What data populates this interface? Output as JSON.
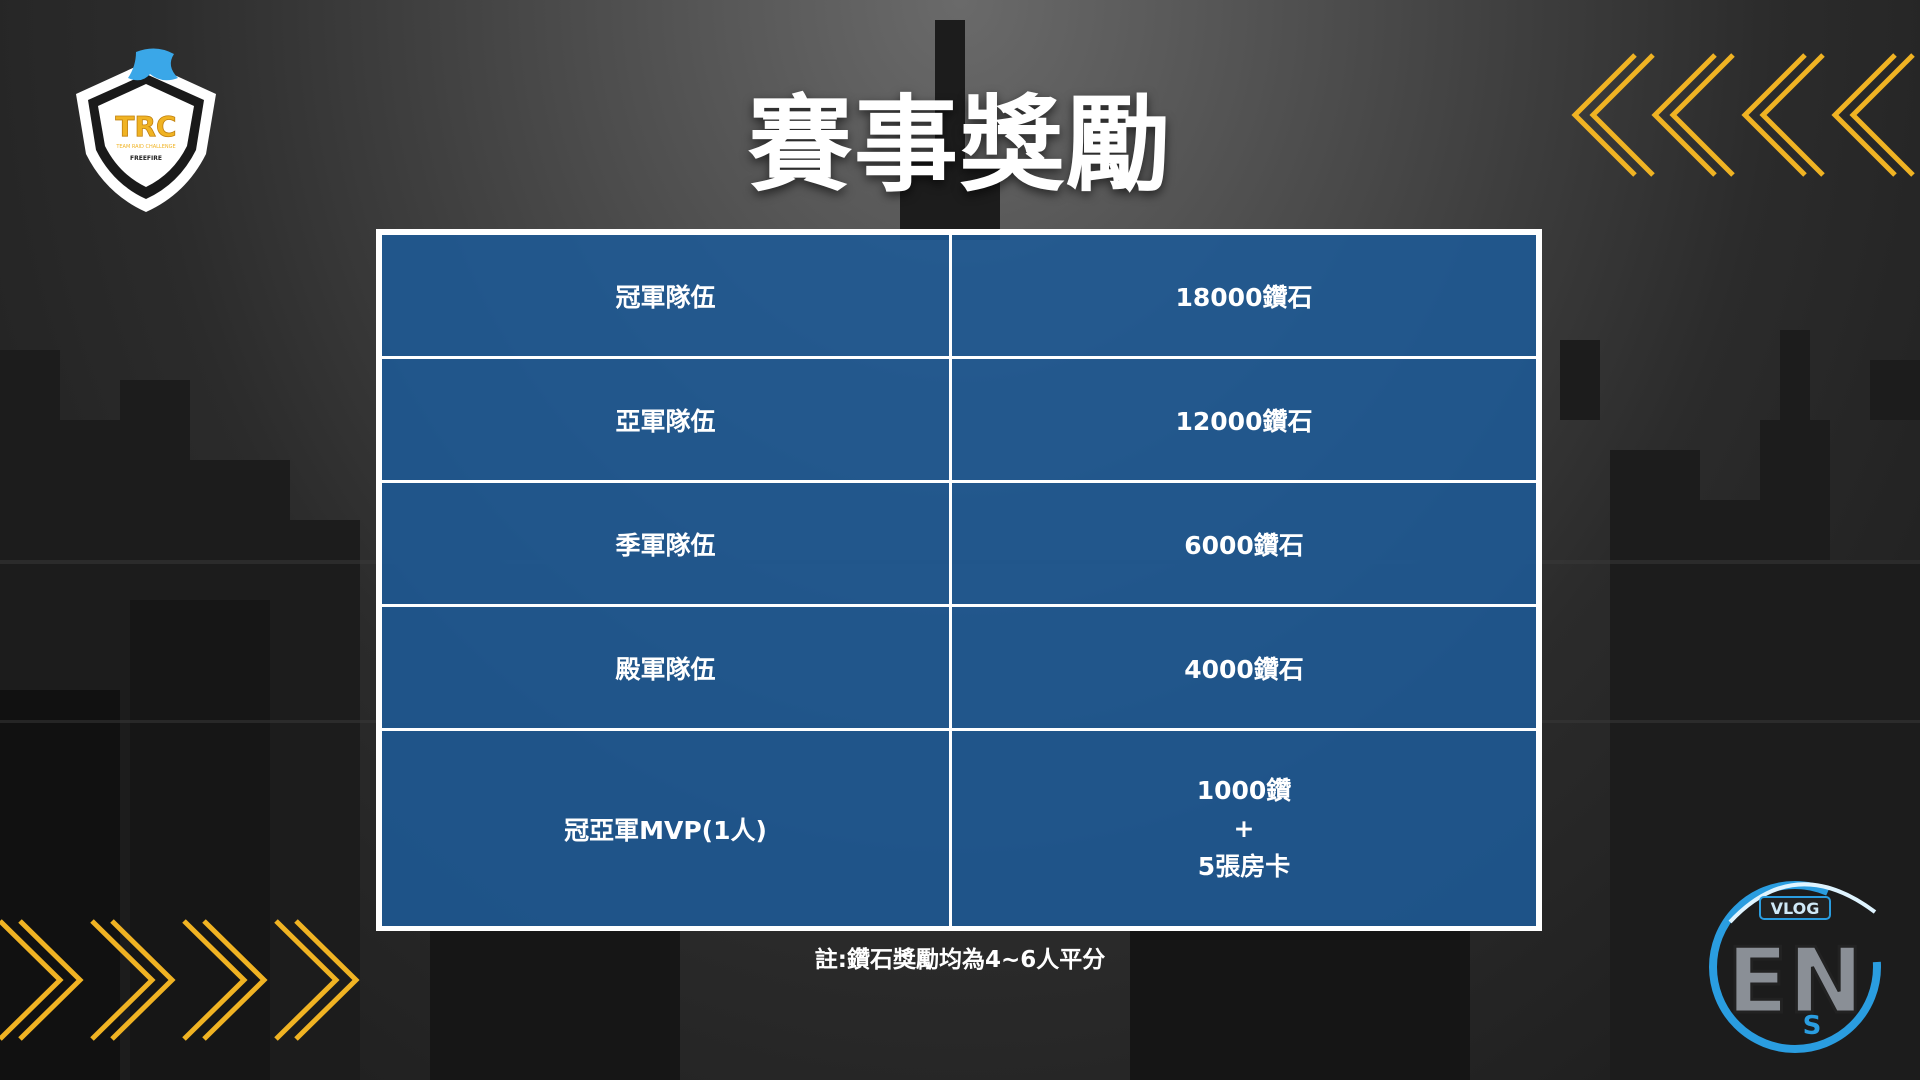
{
  "title": "賽事獎勵",
  "logos": {
    "trc_text": "TRC",
    "trc_sub": "TEAM RAID CHALLENGE",
    "trc_brand": "FREEFIRE",
    "ens_tag": "VLOG",
    "ens_text": "EN",
    "ens_s": "S"
  },
  "rewards": [
    {
      "place": "冠軍隊伍",
      "reward": "18000鑽石"
    },
    {
      "place": "亞軍隊伍",
      "reward": "12000鑽石"
    },
    {
      "place": "季軍隊伍",
      "reward": "6000鑽石"
    },
    {
      "place": "殿軍隊伍",
      "reward": "4000鑽石"
    }
  ],
  "mvp": {
    "place": "冠亞軍MVP(1人)",
    "line1": "1000鑽",
    "line2": "+",
    "line3": "5張房卡"
  },
  "note": "註:鑽石獎勵均為4~6人平分",
  "colors": {
    "accent_yellow": "#f0b323",
    "table_blue": "#1e5a96",
    "text": "#ffffff"
  }
}
